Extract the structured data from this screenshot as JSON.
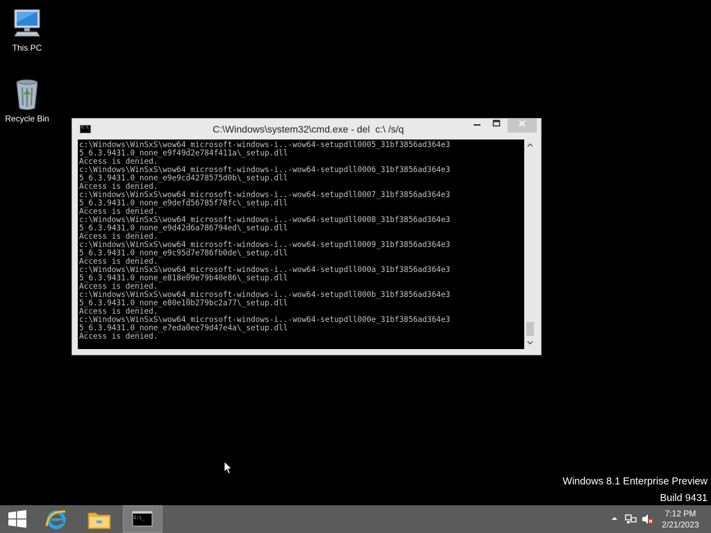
{
  "desktop": {
    "icons": [
      {
        "label": "This PC",
        "icon": "this-pc-icon"
      },
      {
        "label": "Recycle Bin",
        "icon": "recycle-bin-icon"
      }
    ],
    "watermark": {
      "line1": "Windows 8.1 Enterprise Preview",
      "line2": "Build 9431"
    }
  },
  "cmd_window": {
    "title": "C:\\Windows\\system32\\cmd.exe - del  c:\\ /s/q",
    "minimize_label": "—",
    "maximize_label": "☐",
    "close_label": "✕",
    "console_lines": [
      "c:\\Windows\\WinSxS\\wow64_microsoft-windows-i..-wow64-setupdll0005_31bf3856ad364e3",
      "5_6.3.9431.0_none_e9f49d2e784f411a\\_setup.dll",
      "Access is denied.",
      "c:\\Windows\\WinSxS\\wow64_microsoft-windows-i..-wow64-setupdll0006_31bf3856ad364e3",
      "5_6.3.9431.0_none_e9e9cd4278575d0b\\_setup.dll",
      "Access is denied.",
      "c:\\Windows\\WinSxS\\wow64_microsoft-windows-i..-wow64-setupdll0007_31bf3856ad364e3",
      "5_6.3.9431.0_none_e9defd56785f78fc\\_setup.dll",
      "Access is denied.",
      "c:\\Windows\\WinSxS\\wow64_microsoft-windows-i..-wow64-setupdll0008_31bf3856ad364e3",
      "5_6.3.9431.0_none_e9d42d6a786794ed\\_setup.dll",
      "Access is denied.",
      "c:\\Windows\\WinSxS\\wow64_microsoft-windows-i..-wow64-setupdll0009_31bf3856ad364e3",
      "5_6.3.9431.0_none_e9c95d7e786fb0de\\_setup.dll",
      "Access is denied.",
      "c:\\Windows\\WinSxS\\wow64_microsoft-windows-i..-wow64-setupdll000a_31bf3856ad364e3",
      "5_6.3.9431.0_none_e818e09e79b40e86\\_setup.dll",
      "Access is denied.",
      "c:\\Windows\\WinSxS\\wow64_microsoft-windows-i..-wow64-setupdll000b_31bf3856ad364e3",
      "5_6.3.9431.0_none_e80e10b279bc2a77\\_setup.dll",
      "Access is denied.",
      "c:\\Windows\\WinSxS\\wow64_microsoft-windows-i..-wow64-setupdll000e_31bf3856ad364e3",
      "5_6.3.9431.0_none_e7eda0ee79d47e4a\\_setup.dll",
      "Access is denied."
    ]
  },
  "taskbar": {
    "buttons": [
      "start-button",
      "internet-explorer-button",
      "file-explorer-button",
      "command-prompt-button"
    ],
    "clock": {
      "time": "7:12 PM",
      "date": "2/21/2023"
    }
  },
  "colors": {
    "desktop_bg": "#000000",
    "taskbar_bg": "#5b5b5b",
    "window_frame": "#e8e8e8",
    "console_text": "#c0c0c0"
  }
}
